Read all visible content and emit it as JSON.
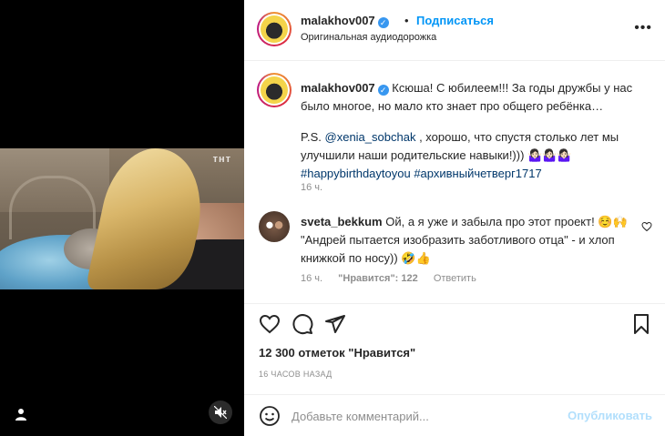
{
  "media": {
    "watermark": "тнт",
    "mute_icon": "speaker-muted-icon",
    "user_tag_icon": "user-icon"
  },
  "header": {
    "username": "malakhov007",
    "verified_icon": "verified-badge-icon",
    "separator": "•",
    "follow_label": "Подписаться",
    "subtitle": "Оригинальная аудиодорожка",
    "more_icon": "more-icon"
  },
  "caption": {
    "username": "malakhov007",
    "line1": "Ксюша! С юбилеем!!! За годы дружбы у нас",
    "line2": "было многое, но мало кто знает про общего ребёнка…",
    "ps_prefix": "P.S. ",
    "mention": "@xenia_sobchak",
    "line3_rest": " , хорошо, что спустя столько лет мы",
    "line4": "улучшили наши родительские навыки!))) 🤷🏻‍♀️🤷🏻‍♀️🤷🏻‍♀️",
    "hashtag1": "#happybirthdaytoyou",
    "hashtag2": "#архивныйчетверг1717",
    "time": "16 ч."
  },
  "comment": {
    "username": "sveta_bekkum",
    "text_line1": " Ой, а я уже и забыла про этот проект! ☺️🙌",
    "text_line2": "\"Андрей пытается изобразить заботливого отца\" - и хлоп",
    "text_line3": "книжкой по носу)) 🤣👍",
    "time": "16 ч.",
    "likes": "\"Нравится\": 122",
    "reply": "Ответить",
    "like_icon": "heart-icon"
  },
  "actions": {
    "like_icon": "heart-icon",
    "comment_icon": "comment-icon",
    "share_icon": "share-icon",
    "save_icon": "bookmark-icon",
    "likes_text": "12 300 отметок \"Нравится\"",
    "date": "16 ЧАСОВ НАЗАД"
  },
  "add_comment": {
    "emoji_icon": "emoji-icon",
    "placeholder": "Добавьте комментарий...",
    "post_label": "Опубликовать"
  }
}
